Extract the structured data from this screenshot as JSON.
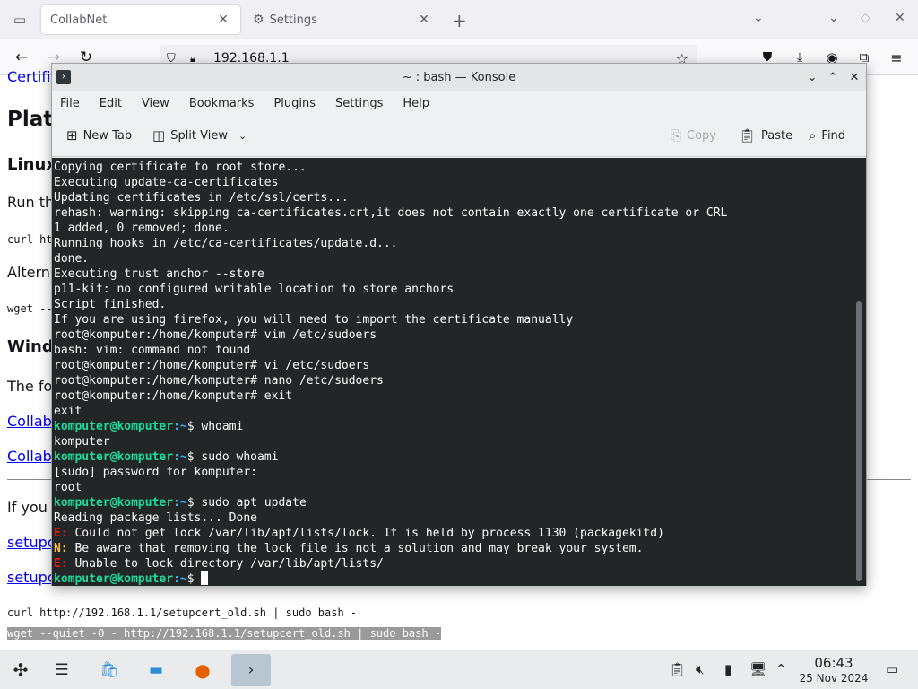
{
  "browser": {
    "tabs": [
      {
        "title": "CollabNet",
        "icon": "collabnet-favicon"
      },
      {
        "title": "Settings",
        "icon": "gear-icon"
      }
    ],
    "url": "192.168.1.1"
  },
  "page": {
    "link_partial_top": "Certifi",
    "heading_platform": "Plat",
    "heading_linux": "Linux",
    "run_text": "Run th",
    "curl_partial": "curl ht",
    "alt_text": "Altern",
    "wget_partial": "wget --",
    "heading_windows": "Wind",
    "following_text": "The fo",
    "link_collab_1": "Collab",
    "link_collab_2": "Collab",
    "if_you_text": "If you",
    "link_setup_1": "setupc",
    "link_setup_2": "setupc",
    "curl_cmd": "curl http://192.168.1.1/setupcert_old.sh | sudo bash -",
    "wget_cmd": "wget --quiet -O - http://192.168.1.1/setupcert_old.sh | sudo bash -"
  },
  "konsole": {
    "title": "~ : bash — Konsole",
    "menu": [
      "File",
      "Edit",
      "View",
      "Bookmarks",
      "Plugins",
      "Settings",
      "Help"
    ],
    "toolbar": {
      "new_tab": "New Tab",
      "split_view": "Split View",
      "copy": "Copy",
      "paste": "Paste",
      "find": "Find"
    },
    "terminal": {
      "output_1": [
        "Copying certificate to root store...",
        "Executing update-ca-certificates",
        "Updating certificates in /etc/ssl/certs...",
        "rehash: warning: skipping ca-certificates.crt,it does not contain exactly one certificate or CRL",
        "1 added, 0 removed; done.",
        "Running hooks in /etc/ca-certificates/update.d...",
        "done.",
        "Executing trust anchor --store",
        "p11-kit: no configured writable location to store anchors",
        "Script finished.",
        "If you are using firefox, you will need to import the certificate manually",
        "root@komputer:/home/komputer# vim /etc/sudoers",
        "bash: vim: command not found",
        "root@komputer:/home/komputer# vi /etc/sudoers",
        "root@komputer:/home/komputer# nano /etc/sudoers",
        "root@komputer:/home/komputer# exit",
        "exit"
      ],
      "prompt_user": "komputer@komputer",
      "prompt_path": ":~",
      "prompt_sign": "$ ",
      "cmd_1": "whoami",
      "out_1": "komputer",
      "cmd_2": "sudo whoami",
      "out_2a": "[sudo] password for komputer:",
      "out_2b": "root",
      "cmd_3": "sudo apt update",
      "out_3": "Reading package lists... Done",
      "err_e": "E:",
      "err_n": "N:",
      "err_1": " Could not get lock /var/lib/apt/lists/lock. It is held by process 1130 (packagekitd)",
      "err_2": " Be aware that removing the lock file is not a solution and may break your system.",
      "err_3": " Unable to lock directory /var/lib/apt/lists/"
    }
  },
  "taskbar": {
    "time": "06:43",
    "date": "25 Nov 2024"
  }
}
